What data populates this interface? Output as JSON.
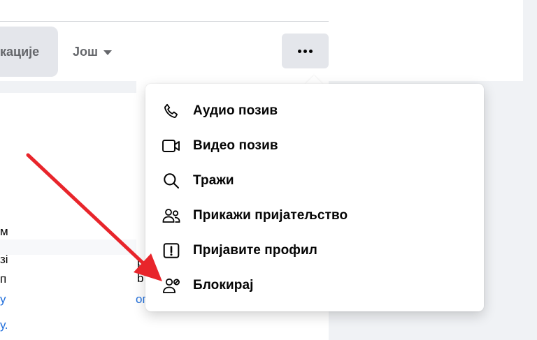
{
  "tabs": {
    "active_label": "кације",
    "more_label": "Још"
  },
  "menu": {
    "items": [
      {
        "label": "Аудио позив",
        "icon": "phone-icon"
      },
      {
        "label": "Видео позив",
        "icon": "video-camera-icon"
      },
      {
        "label": "Тражи",
        "icon": "search-icon"
      },
      {
        "label": "Прикажи пријатељство",
        "icon": "friends-icon"
      },
      {
        "label": "Пријавите профил",
        "icon": "report-icon"
      },
      {
        "label": "Блокирај",
        "icon": "block-user-icon"
      }
    ]
  },
  "background_fragments": {
    "left": [
      "м",
      "зі",
      "п",
      "у",
      "у."
    ],
    "mid": [
      "р",
      "b",
      "ог"
    ]
  },
  "colors": {
    "annotation_arrow": "#e8252b",
    "link": "#216fdb",
    "button_bg": "#e4e6eb"
  }
}
